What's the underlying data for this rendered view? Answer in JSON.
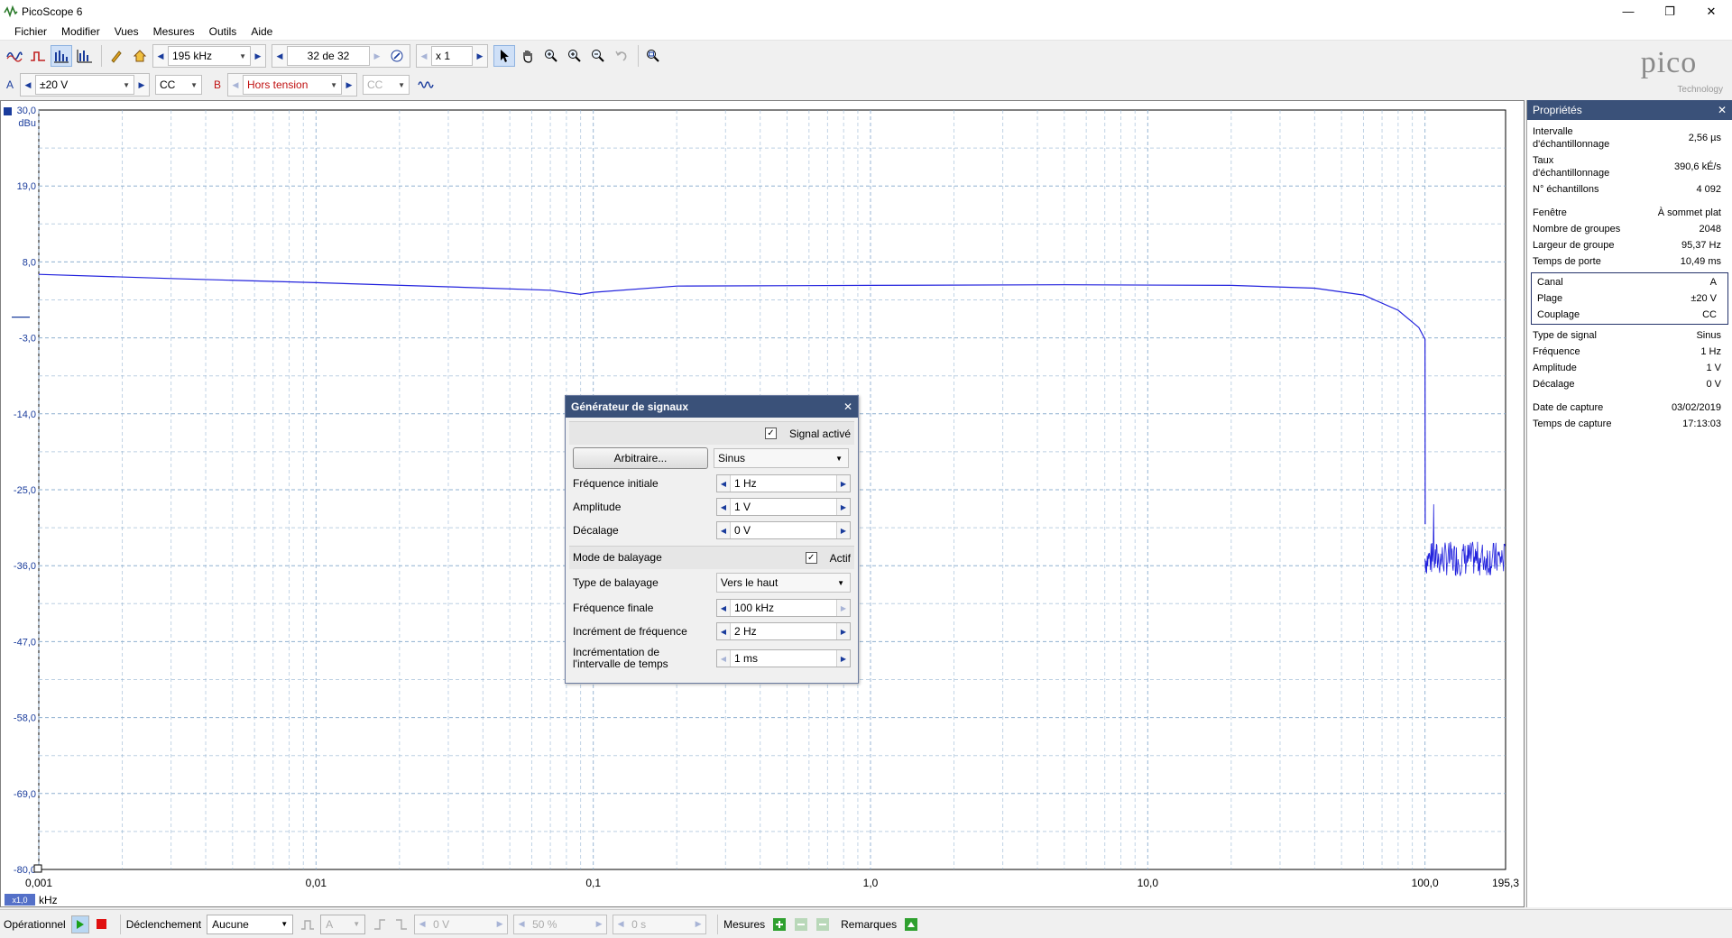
{
  "window": {
    "title": "PicoScope 6",
    "minimize": "—",
    "maximize": "❐",
    "close": "✕"
  },
  "menu": [
    "Fichier",
    "Modifier",
    "Vues",
    "Mesures",
    "Outils",
    "Aide"
  ],
  "toolbar1": {
    "freq_range": "195 kHz",
    "buffer": "32 de 32",
    "zoom": "x 1"
  },
  "toolbar2": {
    "chan_a_label": "A",
    "chan_a_range": "±20 V",
    "chan_a_coupling": "CC",
    "chan_b_label": "B",
    "chan_b_range": "Hors tension",
    "chan_b_coupling": "CC"
  },
  "logo": {
    "name": "pico",
    "sub": "Technology"
  },
  "properties": {
    "title": "Propriétés",
    "group1": [
      {
        "key": "Intervalle d'échantillonnage",
        "value": "2,56 µs"
      },
      {
        "key": "Taux d'échantillonnage",
        "value": "390,6 kÉ/s"
      },
      {
        "key": "N° échantillons",
        "value": "4 092"
      }
    ],
    "group2": [
      {
        "key": "Fenêtre",
        "value": "À sommet plat"
      },
      {
        "key": "Nombre de groupes",
        "value": "2048"
      },
      {
        "key": "Largeur de groupe",
        "value": "95,37 Hz"
      },
      {
        "key": "Temps de porte",
        "value": "10,49 ms"
      }
    ],
    "channel_box": [
      {
        "key": "Canal",
        "value": "A"
      },
      {
        "key": "Plage",
        "value": "±20 V"
      },
      {
        "key": "Couplage",
        "value": "CC"
      }
    ],
    "group3": [
      {
        "key": "Type de signal",
        "value": "Sinus"
      },
      {
        "key": "Fréquence",
        "value": "1 Hz"
      },
      {
        "key": "Amplitude",
        "value": "1 V"
      },
      {
        "key": "Décalage",
        "value": "0 V"
      }
    ],
    "group4": [
      {
        "key": "Date de capture",
        "value": "03/02/2019"
      },
      {
        "key": "Temps de capture",
        "value": "17:13:03"
      }
    ]
  },
  "dialog": {
    "title": "Générateur de signaux",
    "signal_active_label": "Signal activé",
    "signal_active": true,
    "arbitrary_button": "Arbitraire...",
    "wave_type": "Sinus",
    "start_freq_label": "Fréquence initiale",
    "start_freq": "1 Hz",
    "amplitude_label": "Amplitude",
    "amplitude": "1 V",
    "offset_label": "Décalage",
    "offset": "0 V",
    "sweep_mode_label": "Mode de balayage",
    "sweep_active_label": "Actif",
    "sweep_active": true,
    "sweep_type_label": "Type de balayage",
    "sweep_type": "Vers le haut",
    "end_freq_label": "Fréquence finale",
    "end_freq": "100 kHz",
    "freq_increment_label": "Incrément de fréquence",
    "freq_increment": "2 Hz",
    "time_increment_label": "Incrémentation de l'intervalle de temps",
    "time_increment": "1 ms"
  },
  "statusbar": {
    "run_state": "Opérationnel",
    "trigger_label": "Déclenchement",
    "trigger_mode": "Aucune",
    "trigger_channel": "A",
    "threshold": "0 V",
    "pretrigger": "50 %",
    "delay": "0 s",
    "measurements_label": "Mesures",
    "notes_label": "Remarques"
  },
  "chart_data": {
    "type": "line",
    "yunit": "dBu",
    "xunit": "kHz",
    "x_scale": "log",
    "xlim": [
      0.001,
      195.3
    ],
    "ylim": [
      -80,
      30
    ],
    "y_ticks": [
      "30,0",
      "19,0",
      "8,0",
      "-3,0",
      "-14,0",
      "-25,0",
      "-36,0",
      "-47,0",
      "-58,0",
      "-69,0",
      "-80,0"
    ],
    "x_ticks": [
      {
        "x": 0.001,
        "label": "0,001"
      },
      {
        "x": 0.01,
        "label": "0,01"
      },
      {
        "x": 0.1,
        "label": "0,1"
      },
      {
        "x": 1.0,
        "label": "1,0"
      },
      {
        "x": 10.0,
        "label": "10,0"
      },
      {
        "x": 100.0,
        "label": "100,0"
      },
      {
        "x": 195.3,
        "label": "195,3"
      }
    ],
    "scale_badge": "x1,0",
    "grid": true,
    "color": "#2222dd",
    "series": [
      {
        "x": [
          0.001,
          0.003,
          0.01,
          0.03,
          0.07,
          0.09,
          0.1,
          0.2,
          1.0,
          5.0,
          20.0,
          40.0,
          60.0,
          80.0,
          95.0,
          100.0,
          100.2
        ],
        "y": [
          6.2,
          5.6,
          5.0,
          4.4,
          3.9,
          3.3,
          3.6,
          4.5,
          4.6,
          4.7,
          4.6,
          4.2,
          3.2,
          1.0,
          -1.5,
          -3.2,
          -30.0
        ]
      }
    ],
    "noise_floor": {
      "x_from": 100.0,
      "x_to": 195.3,
      "y_center": -35.0,
      "y_spread": 2.5,
      "y_peak": -28.0
    }
  }
}
